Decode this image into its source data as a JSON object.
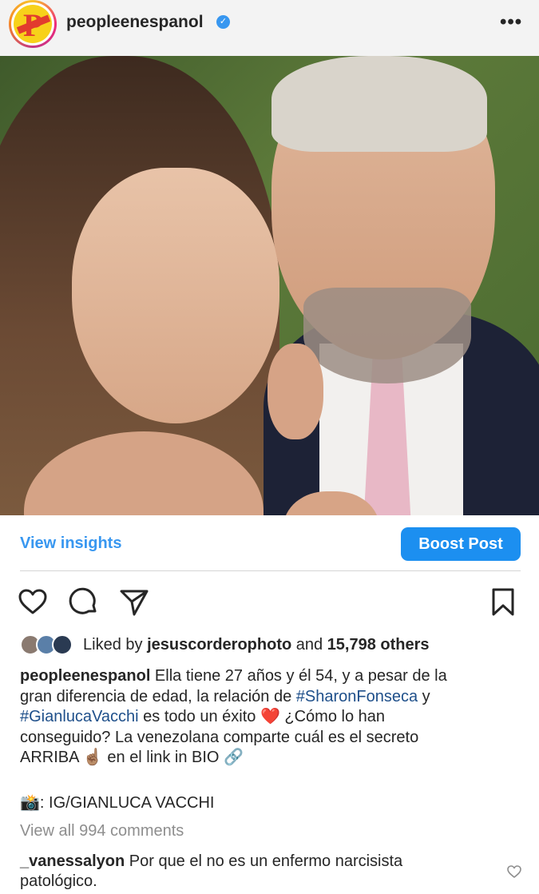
{
  "header": {
    "username": "peopleenespanol",
    "more_label": "•••"
  },
  "actions": {
    "view_insights": "View insights",
    "boost_post": "Boost Post"
  },
  "likes": {
    "prefix": "Liked by ",
    "user": "jesuscorderophoto",
    "middle": " and ",
    "count": "15,798 others"
  },
  "caption": {
    "username": "peopleenespanol",
    "line1": " Ella tiene 27 años y él 54, y a pesar de la",
    "line2_a": "gran diferencia de edad, la relación de ",
    "hashtag1": "#SharonFonseca",
    "line2_b": " y",
    "hashtag2": "#GianlucaVacchi",
    "line3_a": " es todo un éxito ",
    "heart_emoji": "❤️",
    "line3_b": " ¿Cómo lo han",
    "line4": "conseguido? La venezolana comparte cuál es el secreto",
    "line5_a": "ARRIBA ",
    "point_emoji": "☝🏽",
    "line5_b": "  en el link in BIO ",
    "link_emoji": "🔗",
    "credit_emoji": "📸",
    "credit": ": IG/GIANLUCA VACCHI"
  },
  "comments": {
    "view_all": "View all 994 comments",
    "first": {
      "username": "_vanessalyon",
      "text": " Por que el no es un enfermo narcisista patológico."
    }
  },
  "colors": {
    "accent": "#3897f0",
    "boost_bg": "#1c8ff0",
    "hashtag": "#1e4f8a"
  }
}
